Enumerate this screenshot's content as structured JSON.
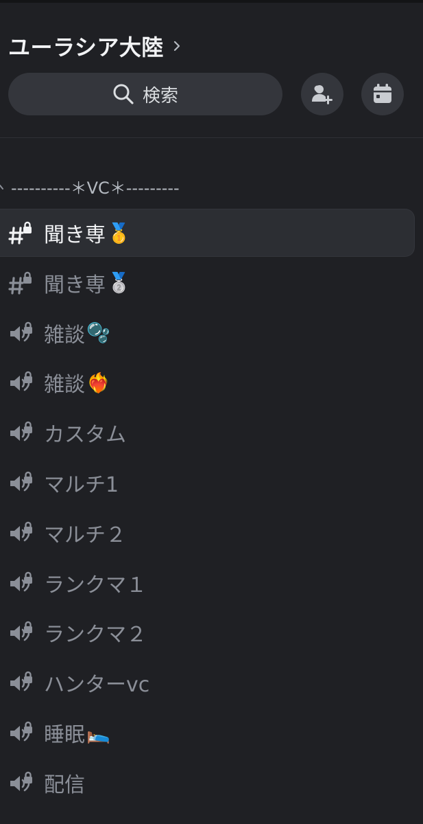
{
  "header": {
    "server_name": "ユーラシア大陸",
    "search_label": "検索"
  },
  "category": {
    "label": "----------＊VC＊---------"
  },
  "channels": [
    {
      "type": "text-locked",
      "name": "聞き専",
      "emoji": "🥇",
      "active": true
    },
    {
      "type": "text-locked",
      "name": "聞き専",
      "emoji": "🥈",
      "active": false
    },
    {
      "type": "voice-locked",
      "name": "雑談",
      "emoji": "🫧",
      "active": false
    },
    {
      "type": "voice-locked",
      "name": "雑談",
      "emoji": "❤️‍🔥",
      "active": false
    },
    {
      "type": "voice-locked",
      "name": "カスタム",
      "emoji": "",
      "active": false
    },
    {
      "type": "voice-locked",
      "name": "マルチ1",
      "emoji": "",
      "active": false
    },
    {
      "type": "voice-locked",
      "name": "マルチ２",
      "emoji": "",
      "active": false
    },
    {
      "type": "voice-locked",
      "name": "ランクマ１",
      "emoji": "",
      "active": false
    },
    {
      "type": "voice-locked",
      "name": "ランクマ２",
      "emoji": "",
      "active": false
    },
    {
      "type": "voice-locked",
      "name": "ハンターvc",
      "emoji": "",
      "active": false
    },
    {
      "type": "voice-locked",
      "name": "睡眠",
      "emoji": "🛌",
      "active": false
    },
    {
      "type": "voice-locked",
      "name": "配信",
      "emoji": "",
      "active": false
    }
  ],
  "colors": {
    "background": "#1f2024",
    "pill": "#34363c",
    "active_row": "#2c2e33",
    "muted_text": "#8b8f98",
    "bright_text": "#f2f3f5"
  }
}
